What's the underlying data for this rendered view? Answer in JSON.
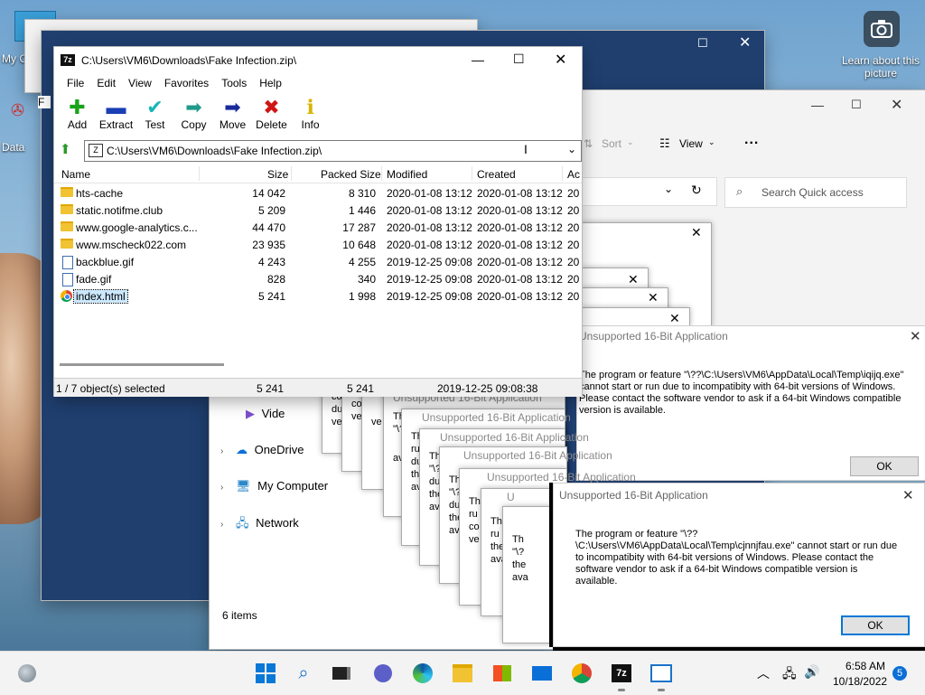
{
  "desktop": {
    "icon1_label": "My C",
    "icon2_label": "Data"
  },
  "snapshot": {
    "label": "Learn about this picture",
    "icon": "camera-icon"
  },
  "zip_window": {
    "title": "C:\\Users\\VM6\\Downloads\\Fake Infection.zip\\",
    "menu": [
      "File",
      "Edit",
      "View",
      "Favorites",
      "Tools",
      "Help"
    ],
    "toolbar": [
      {
        "label": "Add",
        "icon": "plus-icon",
        "color": "#1aa31a",
        "glyph": "✚"
      },
      {
        "label": "Extract",
        "icon": "minus-icon",
        "color": "#1a3fb5",
        "glyph": "▬"
      },
      {
        "label": "Test",
        "icon": "check-icon",
        "color": "#16b6b6",
        "glyph": "✔"
      },
      {
        "label": "Copy",
        "icon": "copy-arrow-icon",
        "color": "#1f9a8a",
        "glyph": "➡"
      },
      {
        "label": "Move",
        "icon": "move-arrow-icon",
        "color": "#1a2a9a",
        "glyph": "➡"
      },
      {
        "label": "Delete",
        "icon": "delete-x-icon",
        "color": "#d01515",
        "glyph": "✖"
      },
      {
        "label": "Info",
        "icon": "info-icon",
        "color": "#d8b400",
        "glyph": "ℹ"
      }
    ],
    "address": "C:\\Users\\VM6\\Downloads\\Fake Infection.zip\\",
    "columns": {
      "name": "Name",
      "size": "Size",
      "packed": "Packed Size",
      "modified": "Modified",
      "created": "Created",
      "accessed": "Ac"
    },
    "rows": [
      {
        "type": "folder",
        "name": "hts-cache",
        "size": "14 042",
        "packed": "8 310",
        "modified": "2020-01-08 13:12",
        "created": "2020-01-08 13:12",
        "accessed": "20"
      },
      {
        "type": "folder",
        "name": "static.notifme.club",
        "size": "5 209",
        "packed": "1 446",
        "modified": "2020-01-08 13:12",
        "created": "2020-01-08 13:12",
        "accessed": "20"
      },
      {
        "type": "folder",
        "name": "www.google-analytics.c...",
        "size": "44 470",
        "packed": "17 287",
        "modified": "2020-01-08 13:12",
        "created": "2020-01-08 13:12",
        "accessed": "20"
      },
      {
        "type": "folder",
        "name": "www.mscheck022.com",
        "size": "23 935",
        "packed": "10 648",
        "modified": "2020-01-08 13:12",
        "created": "2020-01-08 13:12",
        "accessed": "20"
      },
      {
        "type": "file",
        "name": "backblue.gif",
        "size": "4 243",
        "packed": "4 255",
        "modified": "2019-12-25 09:08",
        "created": "2020-01-08 13:12",
        "accessed": "20"
      },
      {
        "type": "file",
        "name": "fade.gif",
        "size": "828",
        "packed": "340",
        "modified": "2019-12-25 09:08",
        "created": "2020-01-08 13:12",
        "accessed": "20"
      },
      {
        "type": "chrome",
        "name": "index.html",
        "size": "5 241",
        "packed": "1 998",
        "modified": "2019-12-25 09:08",
        "created": "2020-01-08 13:12",
        "accessed": "20",
        "selected": true
      }
    ],
    "status": {
      "selection": "1 / 7 object(s) selected",
      "size": "5 241",
      "packed": "5 241",
      "modified": "2019-12-25 09:08:38"
    }
  },
  "explorer": {
    "sort_label": "Sort",
    "view_label": "View",
    "more_label": "...",
    "search_placeholder": "Search Quick access",
    "nav": [
      "Vide",
      "OneDrive",
      "My Computer",
      "Network"
    ],
    "items_count": "6 items"
  },
  "dialogs": {
    "title": "Unsupported 16-Bit Application",
    "msg1": "The program or feature \"\\??\\C:\\Users\\VM6\\AppData\\Local\\Temp\\iqijq.exe\" cannot start or run due to incompatibity with 64-bit versions of Windows. Please contact the software vendor to ask if a 64-bit Windows compatible version is available.",
    "msg2": "The program or feature \"\\??\\C:\\Users\\VM6\\AppData\\Local\\Temp\\cjnnjfau.exe\" cannot start or run due to incompatibity with 64-bit versions of Windows. Please contact the software vendor to ask if a 64-bit Windows compatible version is available.",
    "ok": "OK",
    "frag_th": "Th",
    "frag_2": "\"\\?",
    "frag_ru": "ru",
    "frag_du": "du",
    "frag_the": "the",
    "frag_av": "ava",
    "frag_co": "co",
    "frag_ve": "ve",
    "frag_u": "U"
  },
  "taskbar": {
    "time": "6:58 AM",
    "date": "10/18/2022",
    "notif_count": "5"
  }
}
